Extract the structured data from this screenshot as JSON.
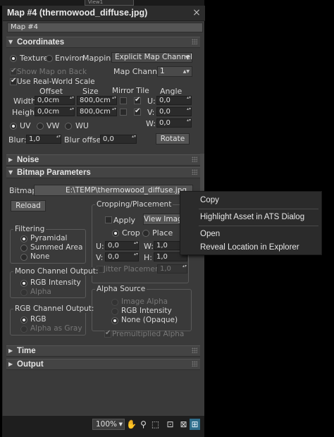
{
  "viewport_tab": "View1",
  "window": {
    "title": "Map #4 (thermowood_diffuse.jpg)",
    "close_glyph": "×"
  },
  "map_name": "Map #4",
  "rollouts": {
    "coordinates": "Coordinates",
    "noise": "Noise",
    "bitmap_parameters": "Bitmap Parameters",
    "time": "Time",
    "output": "Output"
  },
  "coords": {
    "texture": "Texture",
    "environ": "Environ",
    "mapping_label": "Mapping:",
    "mapping_value": "Explicit Map Channel",
    "show_map_on_back": "Show Map on Back",
    "map_channel_label": "Map Channel:",
    "map_channel_value": "1",
    "use_real_world_scale": "Use Real-World Scale",
    "col_offset": "Offset",
    "col_size": "Size",
    "col_mirror_tile": "Mirror Tile",
    "col_angle": "Angle",
    "width_label": "Width:",
    "height_label": "Height:",
    "width_offset": "0,0cm",
    "width_size": "800,0cm",
    "height_offset": "0,0cm",
    "height_size": "800,0cm",
    "u_label": "U:",
    "v_label": "V:",
    "w_label": "W:",
    "angle_u": "0,0",
    "angle_v": "0,0",
    "angle_w": "0,0",
    "uv": "UV",
    "vw": "VW",
    "wu": "WU",
    "blur_label": "Blur:",
    "blur_value": "1,0",
    "blur_offset_label": "Blur offset:",
    "blur_offset_value": "0,0",
    "rotate_button": "Rotate"
  },
  "bitmap": {
    "bitmap_label": "Bitmap:",
    "bitmap_path": "E:\\TEMP\\thermowood_diffuse.jpg",
    "reload_button": "Reload",
    "cropping_title": "Cropping/Placement",
    "apply": "Apply",
    "view_image_button": "View Image",
    "crop": "Crop",
    "place": "Place",
    "u_label": "U:",
    "v_label": "V:",
    "w_label": "W:",
    "h_label": "H:",
    "u_value": "0,0",
    "v_value": "0,0",
    "w_value": "1,0",
    "h_value": "1,0",
    "jitter_placement": "Jitter Placement:",
    "jitter_value": "1,0",
    "filtering_title": "Filtering",
    "pyramidal": "Pyramidal",
    "summed_area": "Summed Area",
    "none": "None",
    "mono_title": "Mono Channel Output:",
    "rgb_intensity": "RGB Intensity",
    "alpha": "Alpha",
    "rgb_title": "RGB Channel Output:",
    "rgb": "RGB",
    "alpha_as_gray": "Alpha as Gray",
    "alpha_source_title": "Alpha Source",
    "image_alpha": "Image Alpha",
    "alpha_rgb_intensity": "RGB Intensity",
    "none_opaque": "None (Opaque)",
    "premultiplied_alpha": "Premultiplied Alpha"
  },
  "statusbar": {
    "zoom": "100%"
  },
  "context_menu": {
    "items": [
      "Copy",
      "Highlight Asset in ATS Dialog",
      "Open",
      "Reveal Location in Explorer"
    ]
  }
}
